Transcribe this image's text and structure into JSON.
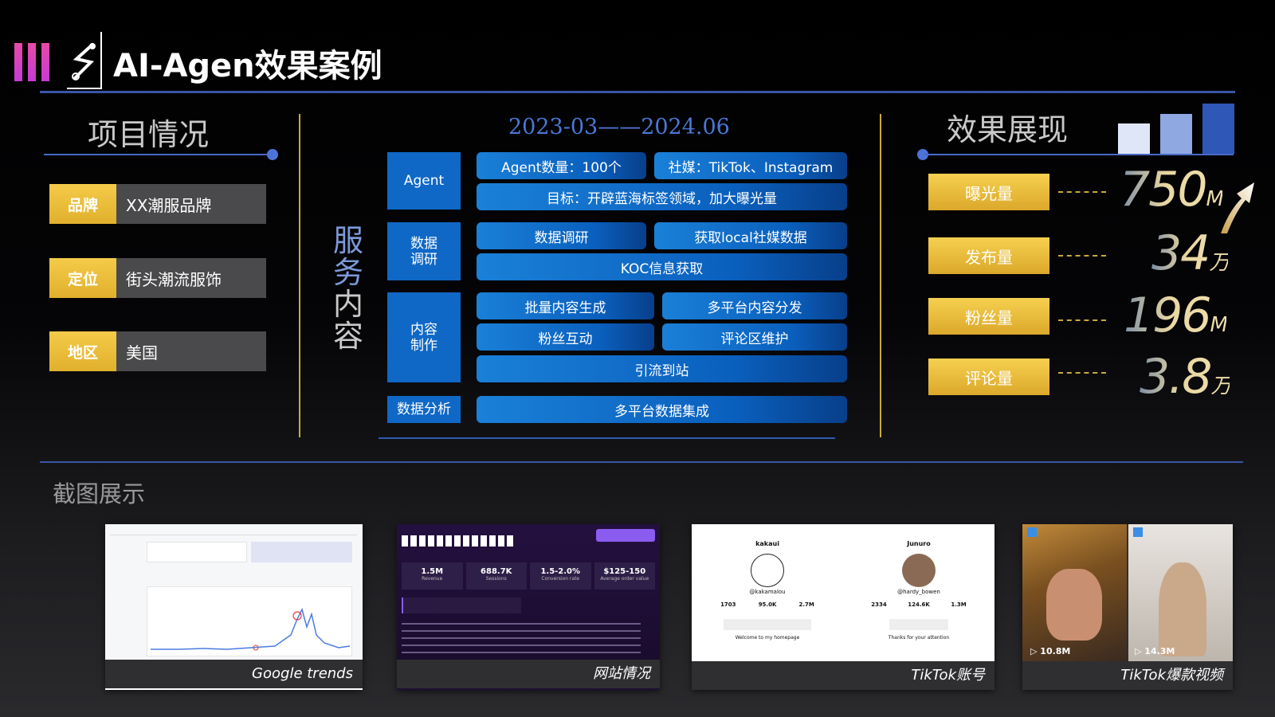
{
  "header": {
    "title": "AI-Agen效果案例"
  },
  "project": {
    "title": "项目情况",
    "rows": [
      {
        "key": "品牌",
        "value": "XX潮服品牌"
      },
      {
        "key": "定位",
        "value": "街头潮流服饰"
      },
      {
        "key": "地区",
        "value": "美国"
      }
    ]
  },
  "services": {
    "date": "2023-03——2024.06",
    "vertical_chars": [
      "服",
      "务",
      "内",
      "容"
    ],
    "categories": [
      "Agent",
      "数据\n调研",
      "内容\n制作",
      "数据分析"
    ],
    "items": {
      "agent_count": "Agent数量：100个",
      "social": "社媒：TikTok、Instagram",
      "goal": "目标：开辟蓝海标签领域，加大曝光量",
      "research": "数据调研",
      "local_data": "获取local社媒数据",
      "koc": "KOC信息获取",
      "batch": "批量内容生成",
      "distribute": "多平台内容分发",
      "fans": "粉丝互动",
      "comments": "评论区维护",
      "traffic": "引流到站",
      "integrate": "多平台数据集成"
    }
  },
  "results": {
    "title": "效果展现",
    "stats": [
      {
        "label": "曝光量",
        "value": "750",
        "unit": "M"
      },
      {
        "label": "发布量",
        "value": "34",
        "unit": "万"
      },
      {
        "label": "粉丝量",
        "value": "196",
        "unit": "M"
      },
      {
        "label": "评论量",
        "value": "3.8",
        "unit": "万"
      }
    ]
  },
  "screenshots": {
    "title": "截图展示",
    "captions": [
      "Google trends",
      "网站情况",
      "TikTok账号",
      "TikTok爆款视频"
    ],
    "site_stats": [
      {
        "value": "1.5M",
        "label": "Revenue"
      },
      {
        "value": "688.7K",
        "label": "Sessions"
      },
      {
        "value": "1.5-2.0%",
        "label": "Conversion rate"
      },
      {
        "value": "$125-150",
        "label": "Average order value"
      }
    ],
    "tiktok_accounts": [
      {
        "name": "kakaui",
        "handle": "@kakamalou",
        "following": "1703",
        "followers": "95.0K",
        "likes": "2.7M",
        "bio": "Welcome to my homepage"
      },
      {
        "name": "Junuro",
        "handle": "@hardy_bowen",
        "following": "2334",
        "followers": "124.6K",
        "likes": "1.3M",
        "bio": "Thanks for your attention"
      }
    ],
    "video_views": [
      "10.8M",
      "14.3M"
    ]
  }
}
